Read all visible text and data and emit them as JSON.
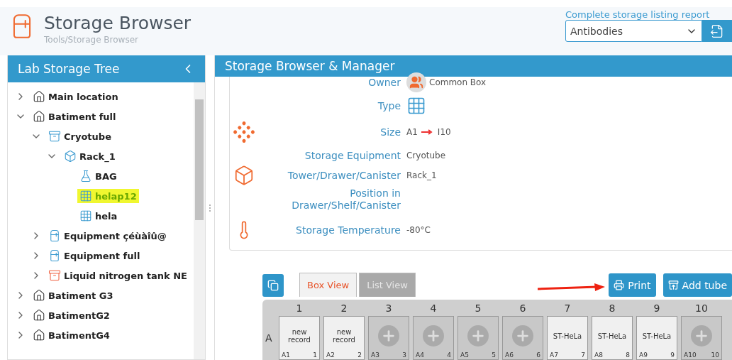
{
  "header": {
    "title": "Storage Browser",
    "breadcrumb": "Tools/Storage Browser",
    "report_link": "Complete storage listing report",
    "report_select": "Antibodies"
  },
  "tree_panel": {
    "title": "Lab Storage Tree",
    "items": [
      {
        "label": "Main location",
        "kind": "house",
        "expanded": false,
        "selected": false
      },
      {
        "label": "Batiment full",
        "kind": "house",
        "expanded": true,
        "selected": false,
        "children": [
          {
            "label": "Cryotube",
            "kind": "container",
            "expanded": true,
            "selected": false,
            "children": [
              {
                "label": "Rack_1",
                "kind": "rack",
                "expanded": true,
                "selected": false,
                "children": [
                  {
                    "label": "BAG",
                    "kind": "tube",
                    "selected": false
                  },
                  {
                    "label": "helap12",
                    "kind": "box",
                    "selected": true
                  },
                  {
                    "label": "hela",
                    "kind": "box",
                    "selected": false
                  }
                ]
              }
            ]
          },
          {
            "label": "Equipment çéùàîû@",
            "kind": "equipment",
            "expanded": false,
            "selected": false
          },
          {
            "label": "Equipment full",
            "kind": "equipment",
            "expanded": false,
            "selected": false
          },
          {
            "label": "Liquid nitrogen tank NE",
            "kind": "tank",
            "expanded": false,
            "selected": false
          }
        ]
      },
      {
        "label": "Batiment G3",
        "kind": "house",
        "expanded": false,
        "selected": false
      },
      {
        "label": "BatimentG2",
        "kind": "house",
        "expanded": false,
        "selected": false
      },
      {
        "label": "BatimentG4",
        "kind": "house",
        "expanded": false,
        "selected": false
      }
    ]
  },
  "manager_panel": {
    "title": "Storage Browser & Manager",
    "details": [
      {
        "label": "Owner",
        "value": "Common Box",
        "kind": "owner"
      },
      {
        "label": "Type",
        "kind": "type"
      },
      {
        "label": "Size",
        "value": "A1",
        "value_end": "I10",
        "kind": "size"
      },
      {
        "label": "Storage Equipment",
        "value": "Cryotube",
        "kind": "text"
      },
      {
        "label": "Tower/Drawer/Canister",
        "value": "Rack_1",
        "kind": "rack"
      },
      {
        "label": "Position in Drawer/Shelf/Canister",
        "kind": "text"
      },
      {
        "label": "Storage Temperature",
        "value": "-80°C",
        "kind": "temperature"
      }
    ],
    "tabs": [
      {
        "label": "Box View",
        "selected": true
      },
      {
        "label": "List View",
        "selected": false
      }
    ],
    "buttons": [
      {
        "label": "Print",
        "kind": "print"
      },
      {
        "label": "Add tube",
        "kind": "add"
      }
    ],
    "columns": [
      "1",
      "2",
      "3",
      "4",
      "5",
      "6",
      "7",
      "8",
      "9",
      "10"
    ],
    "rows": [
      {
        "label": "A",
        "cells": [
          {
            "kind": "record",
            "text": "new record",
            "position": "A1",
            "index": "1"
          },
          {
            "kind": "record",
            "text": "new record",
            "position": "A2",
            "index": "2"
          },
          {
            "kind": "empty",
            "position": "A3",
            "index": "3"
          },
          {
            "kind": "empty",
            "position": "A4",
            "index": "4"
          },
          {
            "kind": "empty",
            "position": "A5",
            "index": "5"
          },
          {
            "kind": "empty",
            "position": "A6",
            "index": "6"
          },
          {
            "kind": "record",
            "text": "ST-HeLa",
            "position": "A7",
            "index": "7"
          },
          {
            "kind": "record",
            "text": "ST-HeLa",
            "position": "A8",
            "index": "8"
          },
          {
            "kind": "record",
            "text": "ST-HeLa",
            "position": "A9",
            "index": "9"
          },
          {
            "kind": "empty",
            "position": "A10",
            "index": "10"
          }
        ]
      }
    ]
  }
}
